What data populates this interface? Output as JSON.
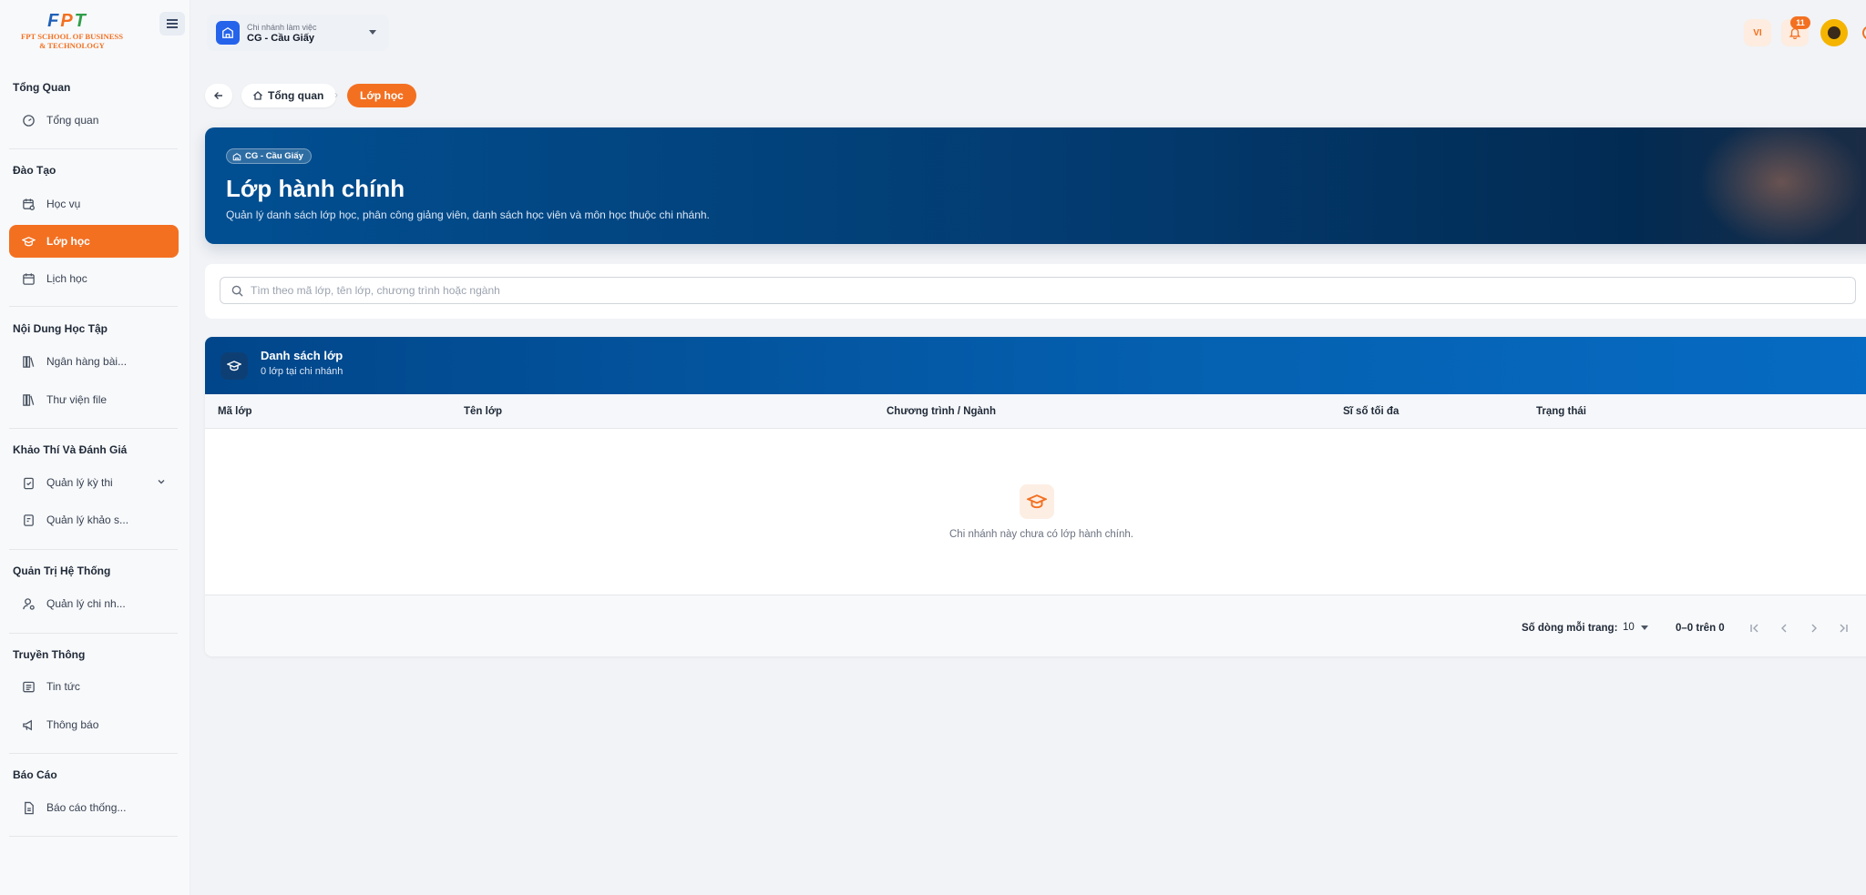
{
  "sidebar": {
    "logo": {
      "letters": [
        "F",
        "P",
        "T"
      ],
      "line1": "FPT SCHOOL OF BUSINESS",
      "line2": "& TECHNOLOGY"
    },
    "sections": [
      {
        "title": "Tổng Quan",
        "items": [
          {
            "label": "Tổng quan",
            "icon": "dashboard-icon"
          }
        ]
      },
      {
        "title": "Đào Tạo",
        "items": [
          {
            "label": "Học vụ",
            "icon": "calendar-user-icon"
          },
          {
            "label": "Lớp học",
            "icon": "graduation-cap-icon",
            "active": true
          },
          {
            "label": "Lịch học",
            "icon": "calendar-icon"
          }
        ]
      },
      {
        "title": "Nội Dung Học Tập",
        "items": [
          {
            "label": "Ngân hàng bài...",
            "icon": "library-icon"
          },
          {
            "label": "Thư viện file",
            "icon": "library-icon"
          }
        ]
      },
      {
        "title": "Khảo Thí Và Đánh Giá",
        "items": [
          {
            "label": "Quản lý kỳ thi",
            "icon": "clipboard-check-icon",
            "expandable": true
          },
          {
            "label": "Quản lý khảo s...",
            "icon": "survey-icon"
          }
        ]
      },
      {
        "title": "Quản Trị Hệ Thống",
        "items": [
          {
            "label": "Quản lý chi nh...",
            "icon": "user-cog-icon"
          }
        ]
      },
      {
        "title": "Truyền Thông",
        "items": [
          {
            "label": "Tin tức",
            "icon": "newspaper-icon"
          },
          {
            "label": "Thông báo",
            "icon": "megaphone-icon"
          }
        ]
      },
      {
        "title": "Báo Cáo",
        "items": [
          {
            "label": "Báo cáo thống...",
            "icon": "report-icon"
          }
        ]
      }
    ]
  },
  "topbar": {
    "branch_label": "Chi nhánh làm việc",
    "branch_value": "CG - Cầu Giấy",
    "language": "VI",
    "notification_count": "11"
  },
  "breadcrumb": {
    "home": "Tổng quan",
    "current": "Lớp học"
  },
  "hero": {
    "chip": "CG - Cầu Giấy",
    "title": "Lớp hành chính",
    "description": "Quản lý danh sách lớp học, phân công giảng viên, danh sách học viên và môn học thuộc chi nhánh."
  },
  "search": {
    "placeholder": "Tìm theo mã lớp, tên lớp, chương trình hoặc ngành",
    "value": ""
  },
  "list": {
    "title": "Danh sách lớp",
    "subtitle": "0 lớp tại chi nhánh",
    "columns": [
      "Mã lớp",
      "Tên lớp",
      "Chương trình / Ngành",
      "Sĩ số tối đa",
      "Trạng thái"
    ],
    "rows": [],
    "empty_message": "Chi nhánh này chưa có lớp hành chính."
  },
  "pagination": {
    "rows_label": "Số dòng mỗi trang:",
    "rows_per_page": "10",
    "range": "0–0 trên 0"
  },
  "colors": {
    "accent": "#f37021",
    "primary": "#014f92",
    "branch_icon": "#2563eb"
  }
}
